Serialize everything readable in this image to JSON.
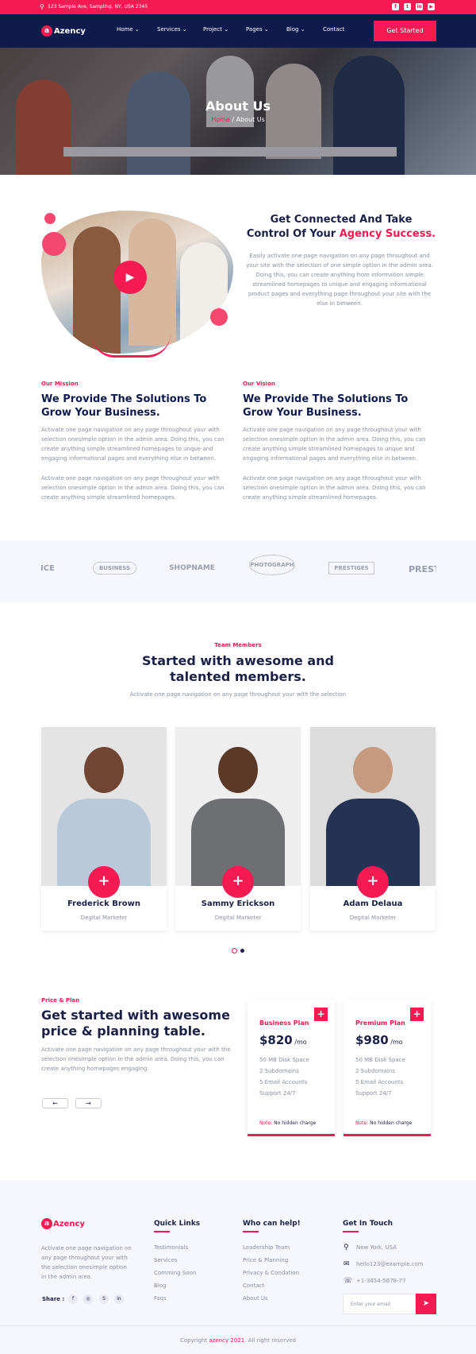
{
  "topbar": {
    "address": "123 Sample Ave, Sampling, NY, USA 2345",
    "socials": [
      "f",
      "t",
      "in",
      "▶"
    ]
  },
  "brand": {
    "name": "Azency",
    "letter": "a"
  },
  "nav": {
    "items": [
      "Home",
      "Services",
      "Project",
      "Pages",
      "Blog",
      "Contact"
    ],
    "caret": "⌄",
    "cta": "Get Started"
  },
  "hero": {
    "title": "About Us",
    "crumb_home": "Home",
    "crumb_sep": " / ",
    "crumb_current": "About Us"
  },
  "about": {
    "title_1": "Get Connected And Take",
    "title_2a": "Control Of Your ",
    "title_2b": "Agency Success.",
    "text": "Easily activate one page navigation on any page throughout and your site with the selection of one simple option in the admin area. Doing this, you can create anything from information simple streamlined homepages to unique and engaging informational product pages and everything page throughout your site with the else in between."
  },
  "mission": {
    "label": "Our Mission",
    "title": "We Provide The Solutions To Grow Your Business.",
    "p1": "Activate one page navigation on any page throughout your with selection onesimple option in the admin area. Doing this, you can create anything simple streamlined homepages to unque and engaging informational pages and everything else in between.",
    "p2": "Activate one page navigation on any page throughout your with selection onesimple option in the admin area. Doing this, you can create anything simple streamlined homepages."
  },
  "vision": {
    "label": "Our Vision",
    "title": "We Provide The Solutions To Grow Your Business.",
    "p1": "Activate one page navigation on any page throughout your with selection onesimple option in the admin area. Doing this, you can create anything simple streamlined homepages to unque and engaging informational pages and everything else in between.",
    "p2": "Activate one page navigation on any page throughout your with selection onesimple option in the admin area. Doing this, you can create anything simple streamlined homepages."
  },
  "brands": [
    "ICE",
    "BUSINESS",
    "SHOPNAME",
    "PHOTOGRAPH",
    "PRESTIGES",
    "PREST"
  ],
  "team": {
    "label": "Team Members",
    "title_1": "Started with awesome and",
    "title_2": "talented members.",
    "subtitle": "Activate one page navigation on any page throughout your with the selection",
    "members": [
      {
        "name": "Frederick Brown",
        "role": "Degital Marketer"
      },
      {
        "name": "Sammy Erickson",
        "role": "Degital Marketer"
      },
      {
        "name": "Adam Delaua",
        "role": "Degital Marketer"
      }
    ]
  },
  "pricing": {
    "label": "Price & Plan",
    "title_1": "Get started with awesome",
    "title_2": "price & planning table.",
    "text": "Activate one page navigation on any page throughout your with the selection onesimple option in the admin area. Doing this, you can create anything homepages engaging.",
    "prev": "←",
    "next": "→",
    "plans": [
      {
        "name": "Business Plan",
        "price": "$820",
        "per": " /mo",
        "features": [
          "50 MB Disk Space",
          "2 Subdomains",
          "5 Email Accounts",
          "Support 24/7"
        ],
        "note_label": "Note:",
        "note": " No hidden charge"
      },
      {
        "name": "Premium Plan",
        "price": "$980",
        "per": " /mo",
        "features": [
          "50 MB Disk Space",
          "2 Subdomains",
          "5 Email Accounts",
          "Support 24/7"
        ],
        "note_label": "Note:",
        "note": " No hidden charge"
      }
    ]
  },
  "footer": {
    "about": "Activate one page navigation on any page throughout your with the selection onesimple option in the admin area.",
    "share_label": "Share :",
    "share_icons": [
      "f",
      "◎",
      "S",
      "in"
    ],
    "quick_title": "Quick Links",
    "quick": [
      "Testimonials",
      "Services",
      "Comming Soon",
      "Blog",
      "Faqs"
    ],
    "help_title": "Who can help!",
    "help": [
      "Leadership Team",
      "Price & Planning",
      "Privacy & Condation",
      "Contact",
      "About Us"
    ],
    "touch_title": "Get In Touch",
    "address": "New York, USA",
    "email": "hello123@example.com",
    "phone": "+1-3454-5678-77",
    "email_placeholder": "Enter your email",
    "copy_a": "Copyright ",
    "copy_b": "azency 2021",
    "copy_c": ". All right reserved"
  },
  "colors": {
    "accent": "#f51b52",
    "navy": "#0f1b4d"
  }
}
